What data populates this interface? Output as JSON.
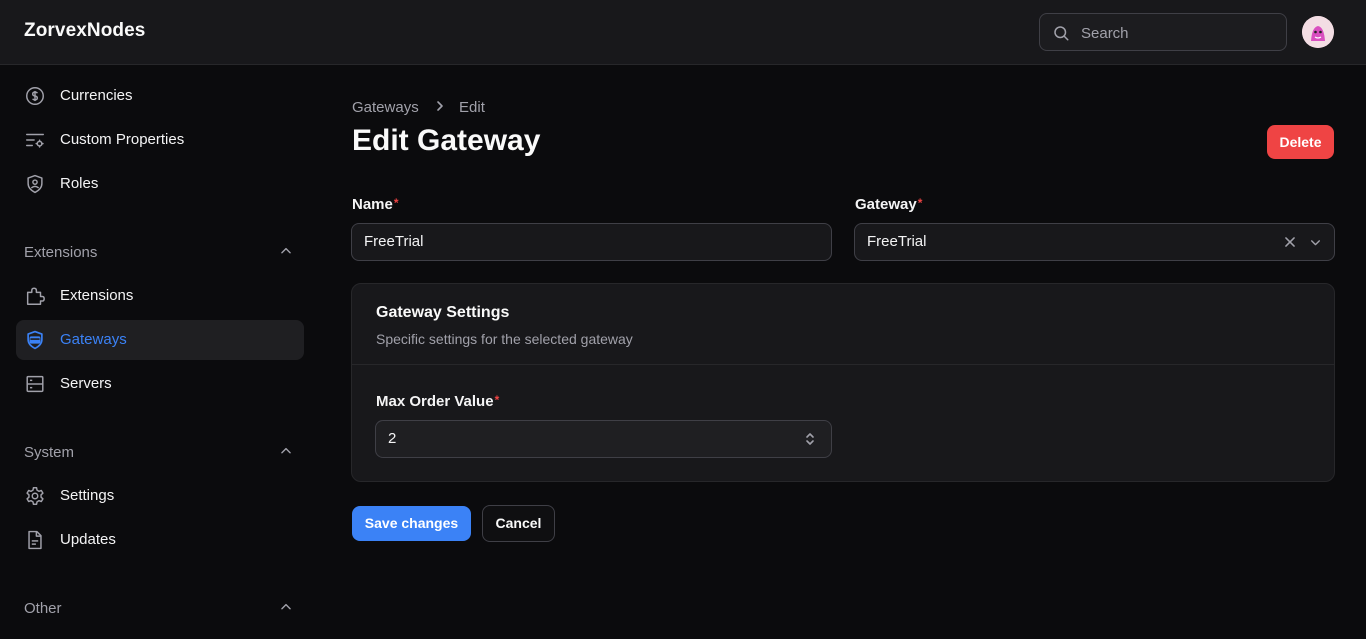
{
  "app": {
    "brand": "ZorvexNodes"
  },
  "header": {
    "search_placeholder": "Search"
  },
  "sidebar": {
    "items_top": [
      {
        "label": "Currencies",
        "icon": "currency-icon"
      },
      {
        "label": "Custom Properties",
        "icon": "custom-properties-icon"
      },
      {
        "label": "Roles",
        "icon": "shield-user-icon"
      }
    ],
    "groups": [
      {
        "label": "Extensions",
        "items": [
          {
            "label": "Extensions",
            "icon": "puzzle-icon"
          },
          {
            "label": "Gateways",
            "icon": "gateway-icon",
            "active": true
          },
          {
            "label": "Servers",
            "icon": "server-icon"
          }
        ]
      },
      {
        "label": "System",
        "items": [
          {
            "label": "Settings",
            "icon": "gear-icon"
          },
          {
            "label": "Updates",
            "icon": "document-icon"
          }
        ]
      },
      {
        "label": "Other",
        "items": []
      }
    ]
  },
  "breadcrumb": {
    "parent": "Gateways",
    "current": "Edit"
  },
  "page": {
    "title": "Edit Gateway",
    "delete_label": "Delete"
  },
  "form": {
    "name": {
      "label": "Name",
      "required_mark": "*",
      "value": "FreeTrial"
    },
    "gateway": {
      "label": "Gateway",
      "required_mark": "*",
      "value": "FreeTrial"
    },
    "settings": {
      "title": "Gateway Settings",
      "subtitle": "Specific settings for the selected gateway",
      "max_order": {
        "label": "Max Order Value",
        "required_mark": "*",
        "value": "2"
      }
    },
    "save_label": "Save changes",
    "cancel_label": "Cancel"
  },
  "colors": {
    "accent": "#3b82f6",
    "danger": "#ef4444",
    "background": "#0b0b0d",
    "surface": "#18181b"
  }
}
